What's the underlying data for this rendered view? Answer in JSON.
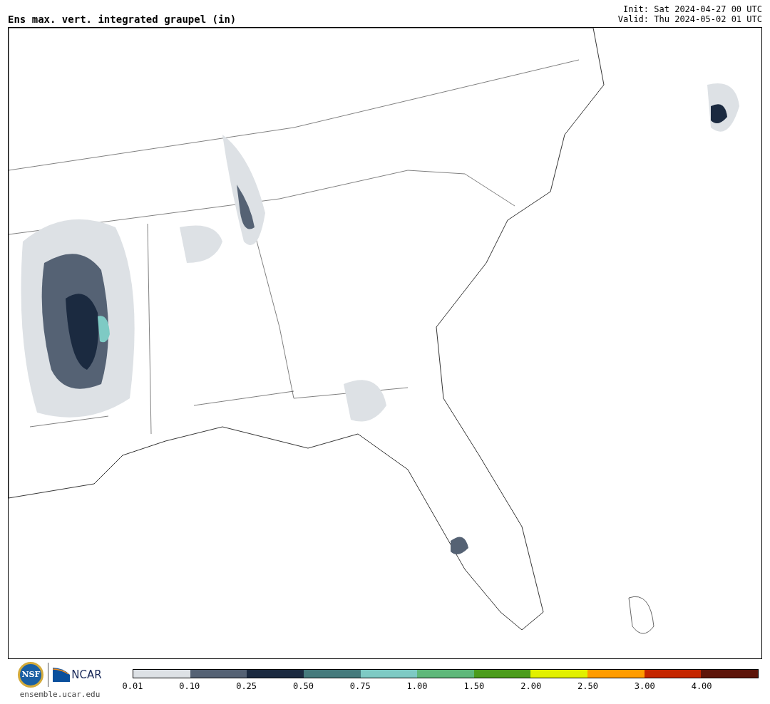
{
  "title": "Ens max. vert. integrated graupel (in)",
  "init": "Init: Sat 2024-04-27 00 UTC",
  "valid": "Valid: Thu 2024-05-02 01 UTC",
  "logos": {
    "nsf": "NSF",
    "ncar": "NCAR",
    "url": "ensemble.ucar.edu"
  },
  "colorbar": {
    "segments": [
      {
        "color": "#dde1e5",
        "label": "0.01"
      },
      {
        "color": "#556274",
        "label": "0.10"
      },
      {
        "color": "#1b2a40",
        "label": "0.25"
      },
      {
        "color": "#457a7c",
        "label": "0.50"
      },
      {
        "color": "#7ecac4",
        "label": "0.75"
      },
      {
        "color": "#5fb87a",
        "label": "1.00"
      },
      {
        "color": "#4c9c1c",
        "label": "1.50"
      },
      {
        "color": "#e2f000",
        "label": "2.00"
      },
      {
        "color": "#ff9c00",
        "label": "2.50"
      },
      {
        "color": "#c52600",
        "label": "3.00"
      },
      {
        "color": "#5d150a",
        "label": "4.00"
      }
    ]
  }
}
